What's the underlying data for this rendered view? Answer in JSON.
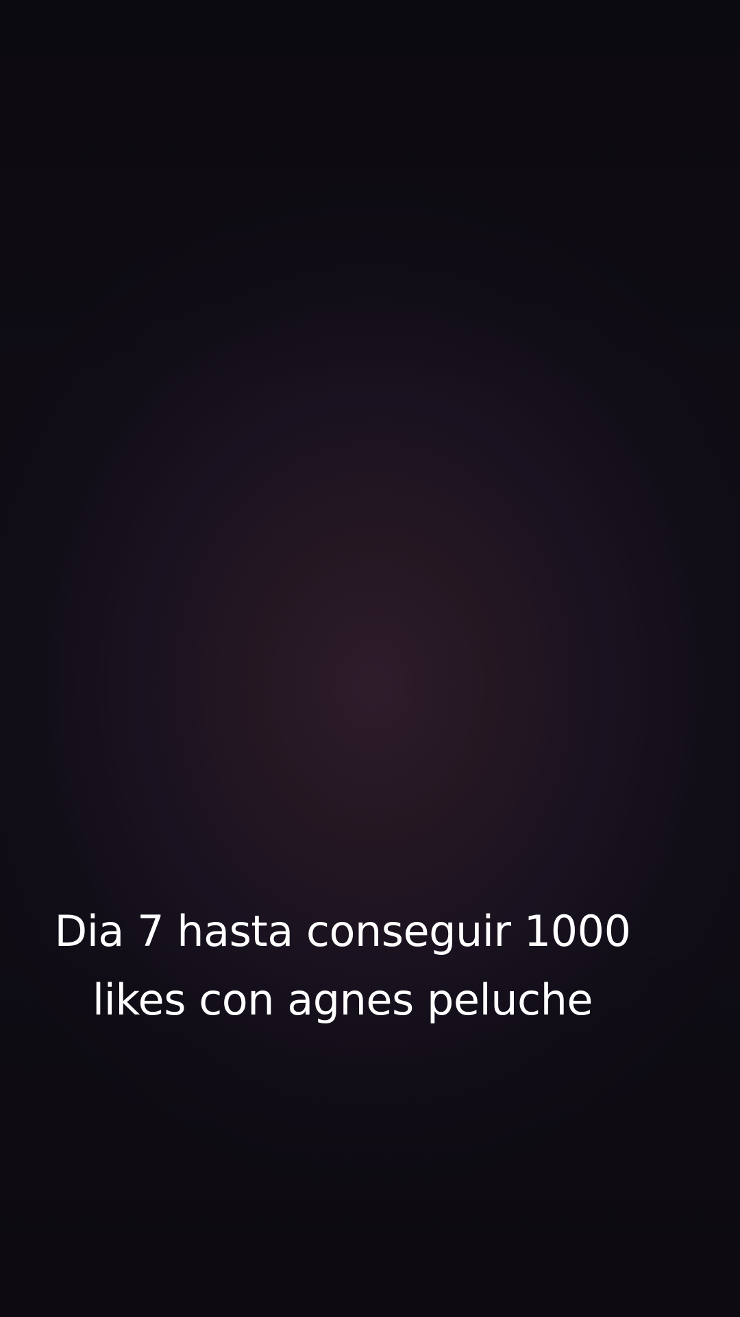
{
  "caption": {
    "line1": "Dia 7 hasta conseguir 1000",
    "line2": "likes con agnes peluche"
  },
  "colors": {
    "background": "#0f0c14",
    "glow": "#2e1c2b",
    "text": "#ffffff"
  }
}
